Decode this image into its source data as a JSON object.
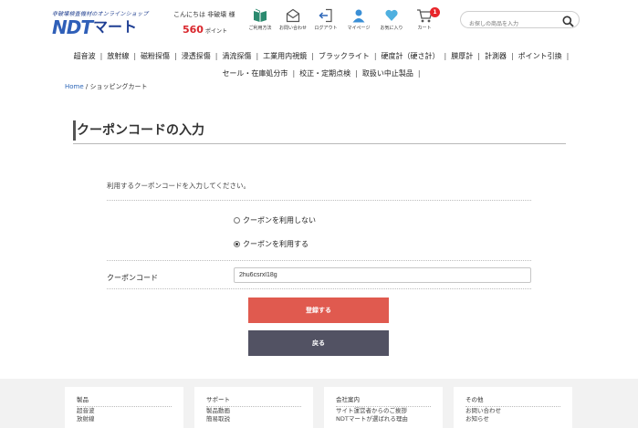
{
  "header": {
    "logo_tagline": "非破壊検査機材のオンラインショップ",
    "logo_ndt": "NDT",
    "logo_mart": "マート",
    "greeting": "こんにちは 非破壊 様",
    "points_value": "560",
    "points_unit": "ポイント",
    "icons": [
      {
        "label": "ご利用方法"
      },
      {
        "label": "お問い合わせ"
      },
      {
        "label": "ログアウト"
      },
      {
        "label": "マイページ"
      },
      {
        "label": "お気に入り"
      },
      {
        "label": "カート"
      }
    ],
    "cart_count": "1",
    "search_placeholder": "お探しの商品を入力",
    "accent_color": "#e8262b"
  },
  "nav": {
    "row1": [
      "超音波",
      "放射線",
      "磁粉探傷",
      "浸透探傷",
      "渦流探傷",
      "工業用内視鏡",
      "ブラックライト",
      "硬度計（硬さ計）",
      "膜厚計",
      "計測器",
      "ポイント引換"
    ],
    "row2": [
      "セール・在庫処分市",
      "校正・定期点検",
      "取扱い中止製品"
    ],
    "separator": "|"
  },
  "breadcrumb": {
    "home": "Home",
    "separator": " / ",
    "current": "ショッピングカート"
  },
  "page": {
    "title": "クーポンコードの入力",
    "instruction": "利用するクーポンコードを入力してください。",
    "option_no": "クーポンを利用しない",
    "option_yes": "クーポンを利用する",
    "code_label": "クーポンコード",
    "code_value": "2hu6csrxl18g",
    "submit_label": "登録する",
    "back_label": "戻る",
    "submit_color": "#e05a4f",
    "back_color": "#525263"
  },
  "footer": {
    "columns": [
      {
        "title": "製品",
        "links": [
          "超音波",
          "放射線"
        ]
      },
      {
        "title": "サポート",
        "links": [
          "製品動画",
          "簡易取説"
        ]
      },
      {
        "title": "会社案内",
        "links": [
          "サイト運営者からのご挨拶",
          "NDTマートが選ばれる理由"
        ]
      },
      {
        "title": "その他",
        "links": [
          "お問い合わせ",
          "お知らせ"
        ]
      }
    ]
  }
}
